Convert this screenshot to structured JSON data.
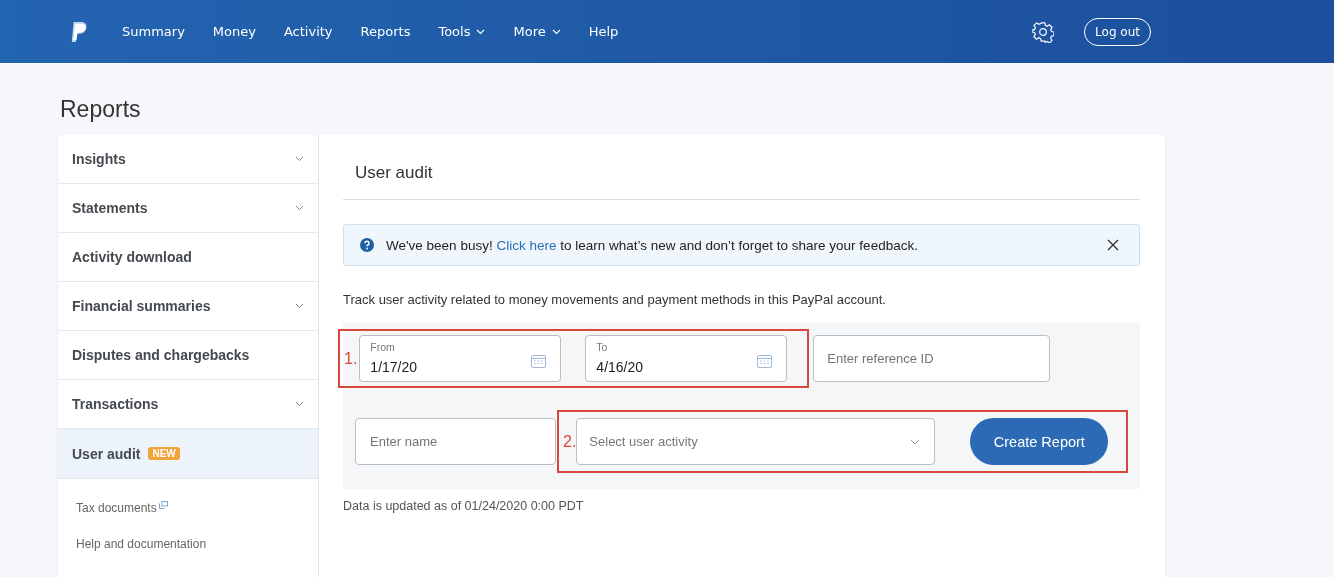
{
  "nav": {
    "items": [
      {
        "label": "Summary",
        "has_menu": false
      },
      {
        "label": "Money",
        "has_menu": false
      },
      {
        "label": "Activity",
        "has_menu": false
      },
      {
        "label": "Reports",
        "has_menu": false
      },
      {
        "label": "Tools",
        "has_menu": true
      },
      {
        "label": "More",
        "has_menu": true
      },
      {
        "label": "Help",
        "has_menu": false
      }
    ],
    "logout": "Log out"
  },
  "page_title": "Reports",
  "sidebar": {
    "items": [
      {
        "kind": "section",
        "label": "Insights",
        "expandable": true,
        "selected": false
      },
      {
        "kind": "section",
        "label": "Statements",
        "expandable": true,
        "selected": false
      },
      {
        "kind": "section",
        "label": "Activity download",
        "expandable": false,
        "selected": false
      },
      {
        "kind": "section",
        "label": "Financial summaries",
        "expandable": true,
        "selected": false
      },
      {
        "kind": "section",
        "label": "Disputes and chargebacks",
        "expandable": false,
        "selected": false
      },
      {
        "kind": "section",
        "label": "Transactions",
        "expandable": true,
        "selected": false
      },
      {
        "kind": "section",
        "label": "User audit",
        "expandable": false,
        "selected": true,
        "badge": "NEW"
      },
      {
        "kind": "link",
        "label": "Tax documents",
        "external": true
      },
      {
        "kind": "link",
        "label": "Help and documentation",
        "external": false
      }
    ]
  },
  "content": {
    "title": "User audit",
    "notice": {
      "before": "We've been busy! ",
      "link": "Click here",
      "after": " to learn what’s new and don’t forget to share your feedback."
    },
    "description": "Track user activity related to money movements and payment methods in this PayPal account.",
    "date_from": {
      "label": "From",
      "value": "1/17/20"
    },
    "date_to": {
      "label": "To",
      "value": "4/16/20"
    },
    "reference": {
      "placeholder": "Enter reference ID"
    },
    "name": {
      "placeholder": "Enter name"
    },
    "activity": {
      "placeholder": "Select user activity"
    },
    "button": "Create Report",
    "annotations": [
      "1.",
      "2."
    ],
    "footnote": "Data is updated as of 01/24/2020 0:00 PDT"
  }
}
